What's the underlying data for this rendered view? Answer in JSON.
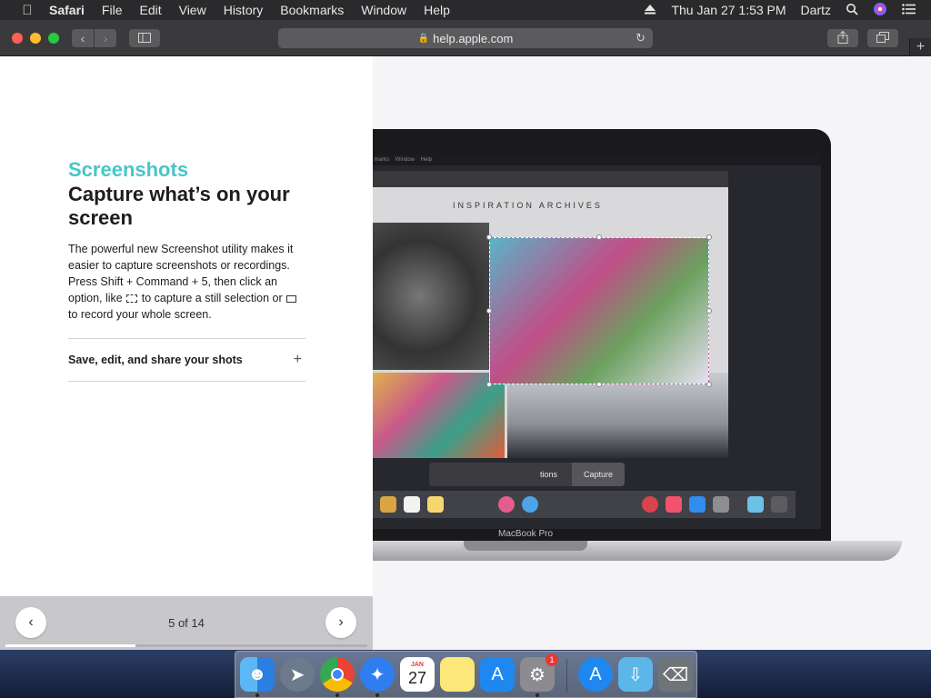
{
  "menubar": {
    "app": "Safari",
    "items": [
      "File",
      "Edit",
      "View",
      "History",
      "Bookmarks",
      "Window",
      "Help"
    ],
    "datetime": "Thu Jan 27  1:53 PM",
    "user": "Dartz"
  },
  "toolbar": {
    "url": "help.apple.com"
  },
  "content": {
    "eyebrow": "Screenshots",
    "headline": "Capture what’s on your screen",
    "body_part1": "The powerful new Screenshot utility makes it easier to capture screenshots or recordings. Press Shift + Command + 5, then click an option, like",
    "body_part2": "to capture a still selection or",
    "body_part3": "to record your whole screen.",
    "accordion_label": "Save, edit, and share your shots",
    "pager": "5 of 14",
    "progress": 0.36
  },
  "illustration": {
    "inner_title": "INSPIRATION ARCHIVES",
    "capture_button": "Capture",
    "options_label": "tions",
    "device_label": "MacBook Pro"
  },
  "dock": {
    "calendar_day": "27",
    "calendar_month": "JAN",
    "settings_badge": "1"
  },
  "colors": {
    "accent": "#49c5c8"
  }
}
